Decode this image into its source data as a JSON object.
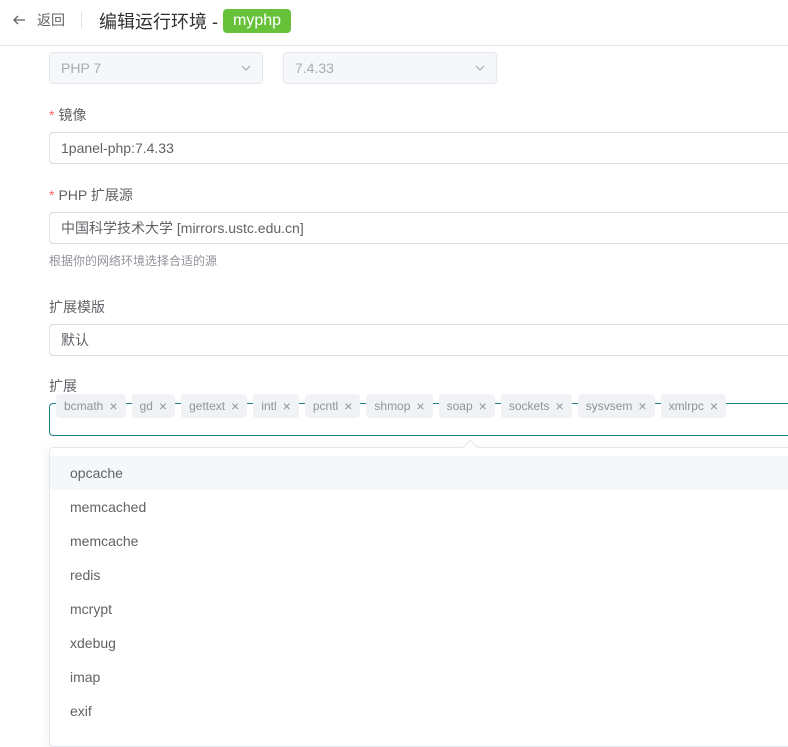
{
  "header": {
    "back_label": "返回",
    "title": "编辑运行环境 -",
    "env_name": "myphp"
  },
  "version": {
    "php_type": "PHP 7",
    "php_version": "7.4.33"
  },
  "image": {
    "label": "镜像",
    "value": "1panel-php:7.4.33"
  },
  "ext_source": {
    "label": "PHP 扩展源",
    "value": "中国科学技术大学 [mirrors.ustc.edu.cn]",
    "help": "根据你的网络环境选择合适的源"
  },
  "ext_template": {
    "label": "扩展模版",
    "value": "默认"
  },
  "extensions": {
    "label": "扩展",
    "tags": [
      "bcmath",
      "gd",
      "gettext",
      "intl",
      "pcntl",
      "shmop",
      "soap",
      "sockets",
      "sysvsem",
      "xmlrpc"
    ],
    "options": [
      "opcache",
      "memcached",
      "memcache",
      "redis",
      "mcrypt",
      "xdebug",
      "imap",
      "exif"
    ],
    "hovered_option": "opcache"
  },
  "colors": {
    "accent": "#1f7f89",
    "tag_green": "#67c23a",
    "required": "#f56c6c"
  }
}
